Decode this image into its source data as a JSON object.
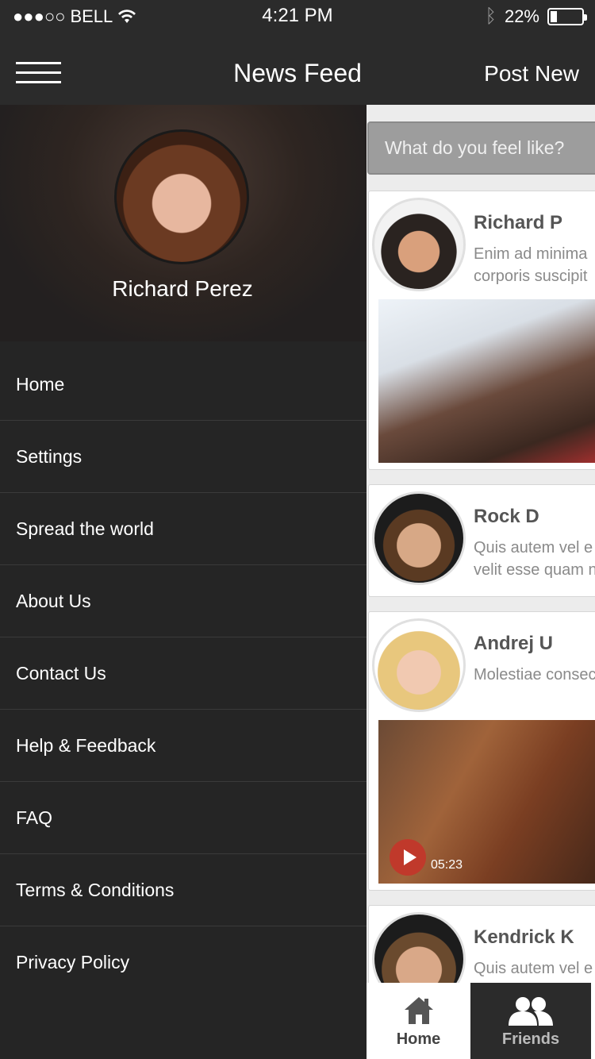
{
  "status": {
    "carrier": "BELL",
    "time": "4:21 PM",
    "battery": "22%",
    "battery_fraction": 0.22
  },
  "navbar": {
    "title": "News Feed",
    "action": "Post New"
  },
  "drawer": {
    "user_name": "Richard Perez",
    "menu": [
      {
        "label": "Home"
      },
      {
        "label": "Settings"
      },
      {
        "label": "Spread  the world"
      },
      {
        "label": "About Us"
      },
      {
        "label": "Contact Us"
      },
      {
        "label": "Help  &  Feedback"
      },
      {
        "label": "FAQ"
      },
      {
        "label": "Terms  &   Conditions"
      },
      {
        "label": "Privacy  Policy"
      }
    ]
  },
  "feed": {
    "search_placeholder": "What do you feel like?",
    "posts": [
      {
        "name": "Richard P",
        "line1": "Enim ad minima",
        "line2": "corporis suscipit"
      },
      {
        "name": "Rock D",
        "line1": "Quis autem vel e",
        "line2": "velit esse quam n"
      },
      {
        "name": "Andrej U",
        "line1": "Molestiae consec",
        "video_duration": "05:23"
      },
      {
        "name": "Kendrick K",
        "line1": "Quis autem vel e"
      }
    ]
  },
  "tabs": {
    "home": "Home",
    "friends": "Friends"
  }
}
